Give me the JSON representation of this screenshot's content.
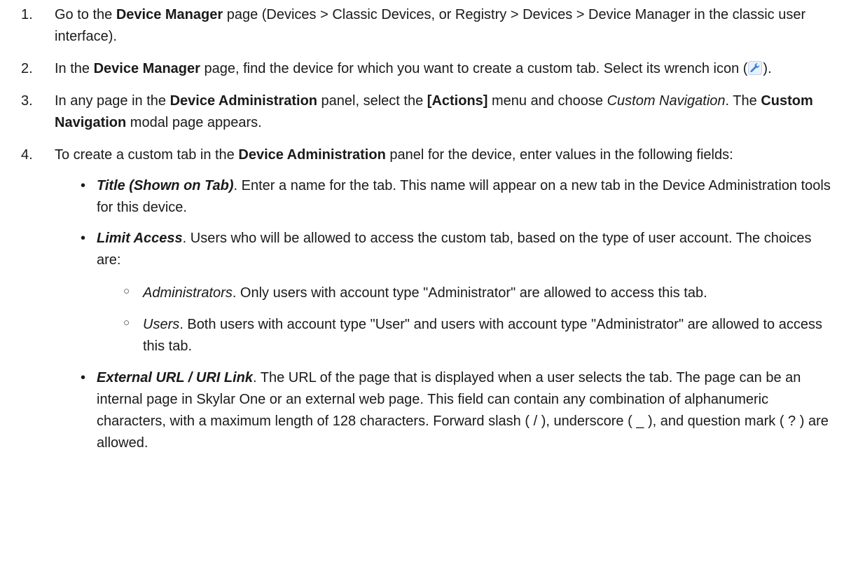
{
  "steps": [
    {
      "number": "1.",
      "parts": {
        "a": "Go to the ",
        "b": "Device Manager",
        "c": " page (Devices > Classic Devices, or Registry > Devices > Device Manager in the classic user interface)."
      }
    },
    {
      "number": "2.",
      "parts": {
        "a": "In the ",
        "b": "Device Manager",
        "c": " page, find the device for which you want to create a custom tab. Select its wrench icon (",
        "icon": "wrench-icon",
        "d": ")."
      }
    },
    {
      "number": "3.",
      "parts": {
        "a": "In any page in the ",
        "b": "Device Administration",
        "c": " panel, select the ",
        "d": "[Actions]",
        "e": " menu and choose ",
        "f": "Custom Navigation",
        "g": ". The ",
        "h": "Custom Navigation",
        "i": " modal page appears."
      }
    },
    {
      "number": "4.",
      "parts": {
        "a": "To create a custom tab in the ",
        "b": "Device Administration",
        "c": " panel for the device, enter values in the following fields:"
      },
      "bullets": [
        {
          "marker": "•",
          "term": "Title (Shown on Tab)",
          "text": ". Enter a name for the tab. This name will appear on a new tab in the Device Administration tools for this device."
        },
        {
          "marker": "•",
          "term": "Limit Access",
          "text": ". Users who will be allowed to access the custom tab, based on the type of user account. The choices are:",
          "sub": [
            {
              "marker": "○",
              "term": "Administrators",
              "text": ". Only users with account type \"Administrator\" are allowed to access this tab."
            },
            {
              "marker": "○",
              "term": "Users",
              "text": ". Both users with account type \"User\" and users with account type \"Administrator\" are allowed to access this tab."
            }
          ]
        },
        {
          "marker": "•",
          "term": "External URL / URI Link",
          "text": ". The URL of the page that is displayed when a user selects the tab. The page can be an internal page in Skylar One or an external web page. This field can contain any combination of alphanumeric characters, with a maximum length of 128 characters. Forward slash ( / ), underscore ( _ ), and question mark ( ? ) are allowed."
        }
      ]
    }
  ],
  "colors": {
    "text": "#1a1a1a",
    "wrench_icon": "#3a7fd5"
  }
}
